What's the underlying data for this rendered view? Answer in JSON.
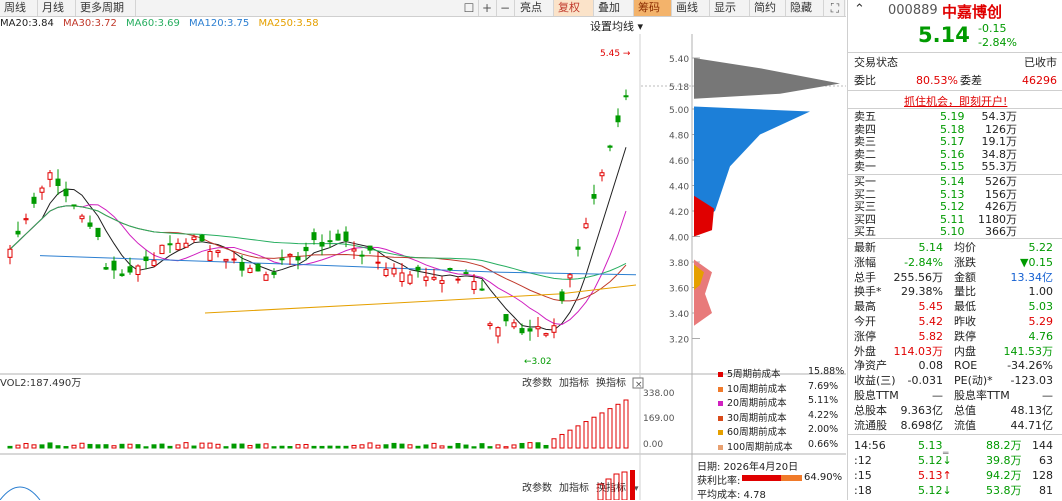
{
  "toolbar": {
    "tabs": [
      "周线",
      "月线",
      "更多周期"
    ],
    "actions": [
      "亮点",
      "复权",
      "叠加",
      "筹码",
      "画线",
      "显示",
      "简约",
      "隐藏"
    ]
  },
  "ma": {
    "ma20": "MA20:3.84",
    "ma30": "MA30:3.72",
    "ma60": "MA60:3.69",
    "ma120": "MA120:3.75",
    "ma250": "MA250:3.58",
    "colors": {
      "ma20": "#1f1f1f",
      "ma30": "#c0392b",
      "ma60": "#27ae60",
      "ma120": "#2c7fd1",
      "ma250": "#e5a000"
    }
  },
  "setting_label": "设置均线",
  "price_axis": [
    "5.40",
    "5.18",
    "5.00",
    "4.80",
    "4.60",
    "4.40",
    "4.20",
    "4.00",
    "3.80",
    "3.60",
    "3.40",
    "3.20"
  ],
  "high_mark": "5.45",
  "low_mark": "3.02",
  "vol": {
    "label": "VOL2:187.490万",
    "axis": [
      "338.00",
      "169.00",
      "0.00"
    ],
    "buttons": [
      "改参数",
      "加指标",
      "换指标"
    ]
  },
  "chips": {
    "legend": [
      {
        "label": "5周期前成本",
        "value": "15.88%",
        "color": "#e00000"
      },
      {
        "label": "10周期前成本",
        "value": "7.69%",
        "color": "#f07a2a"
      },
      {
        "label": "20周期前成本",
        "value": "5.11%",
        "color": "#d020c0"
      },
      {
        "label": "30周期前成本",
        "value": "4.22%",
        "color": "#d84a1a"
      },
      {
        "label": "60周期前成本",
        "value": "2.00%",
        "color": "#e5a000"
      },
      {
        "label": "100周期前成本",
        "value": "0.66%",
        "color": "#e8a070"
      }
    ],
    "date": "日期: 2026年4月20日",
    "profit_label": "获利比率:",
    "profit_value": "64.90%",
    "avg_cost": "平均成本: 4.78"
  },
  "stock": {
    "code": "000889",
    "name": "中嘉博创",
    "price": "5.14",
    "change": "-0.15",
    "change_pct": "-2.84%",
    "status_label": "交易状态",
    "status_value": "已收市",
    "weibi_label": "委比",
    "weibi_value": "80.53%",
    "weicha_label": "委差",
    "weicha_value": "46296",
    "promo": "抓住机会，即刻开户!"
  },
  "asks": [
    {
      "label": "卖五",
      "price": "5.19",
      "vol": "54.3万"
    },
    {
      "label": "卖四",
      "price": "5.18",
      "vol": "126万"
    },
    {
      "label": "卖三",
      "price": "5.17",
      "vol": "19.1万"
    },
    {
      "label": "卖二",
      "price": "5.16",
      "vol": "34.8万"
    },
    {
      "label": "卖一",
      "price": "5.15",
      "vol": "55.3万"
    }
  ],
  "bids": [
    {
      "label": "买一",
      "price": "5.14",
      "vol": "526万"
    },
    {
      "label": "买二",
      "price": "5.13",
      "vol": "156万"
    },
    {
      "label": "买三",
      "price": "5.12",
      "vol": "426万"
    },
    {
      "label": "买四",
      "price": "5.11",
      "vol": "1180万"
    },
    {
      "label": "买五",
      "price": "5.10",
      "vol": "366万"
    }
  ],
  "stats": [
    [
      "最新",
      "5.14",
      "均价",
      "5.22"
    ],
    [
      "涨幅",
      "-2.84%",
      "涨跌",
      "▼0.15"
    ],
    [
      "总手",
      "255.56万",
      "金额",
      "13.34亿"
    ],
    [
      "换手*",
      "29.38%",
      "量比",
      "1.00"
    ],
    [
      "最高",
      "5.45",
      "最低",
      "5.03"
    ],
    [
      "今开",
      "5.42",
      "昨收",
      "5.29"
    ],
    [
      "涨停",
      "5.82",
      "跌停",
      "4.76"
    ],
    [
      "外盘",
      "114.03万",
      "内盘",
      "141.53万"
    ],
    [
      "净资产",
      "0.08",
      "ROE",
      "-34.26%"
    ],
    [
      "收益(三)",
      "-0.031",
      "PE(动)*",
      "-123.03"
    ],
    [
      "股息TTM",
      "—",
      "股息率TTM",
      "—"
    ],
    [
      "总股本",
      "9.363亿",
      "总值",
      "48.13亿"
    ],
    [
      "流通股",
      "8.698亿",
      "流值",
      "44.71亿"
    ]
  ],
  "ticks": [
    {
      "time": "14:56",
      "price": "5.13",
      "vol": "88.2万",
      "n": "144"
    },
    {
      "time": ":12",
      "price": "5.12↓",
      "vol": "39.8万",
      "n": "63"
    },
    {
      "time": ":15",
      "price": "5.13↑",
      "vol": "94.2万",
      "n": "128"
    },
    {
      "time": ":18",
      "price": "5.12↓",
      "vol": "53.8万",
      "n": "81"
    }
  ]
}
